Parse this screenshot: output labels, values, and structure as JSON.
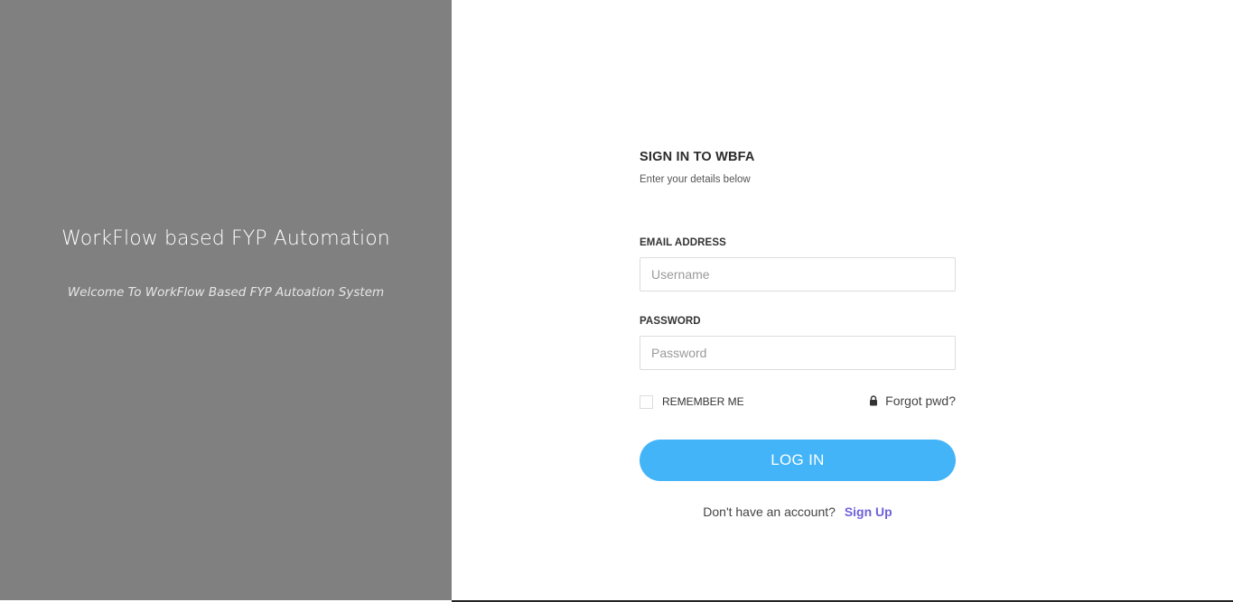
{
  "brand": {
    "title": "WorkFlow based FYP Automation",
    "subtitle": "Welcome To WorkFlow Based FYP Autoation System",
    "panel_color": "#808080"
  },
  "login": {
    "title": "SIGN IN TO WBFA",
    "subtitle": "Enter your details below",
    "email": {
      "label": "EMAIL ADDRESS",
      "placeholder": "Username",
      "value": ""
    },
    "password": {
      "label": "PASSWORD",
      "placeholder": "Password",
      "value": ""
    },
    "remember_label": "REMEMBER ME",
    "remember_checked": false,
    "forgot_label": "Forgot pwd?",
    "forgot_icon": "lock-icon",
    "login_button_label": "LOG IN",
    "login_button_color": "#42b4f7",
    "signup_prompt": "Don't have an account?",
    "signup_link": "Sign Up",
    "signup_link_color": "#6f61d9"
  }
}
